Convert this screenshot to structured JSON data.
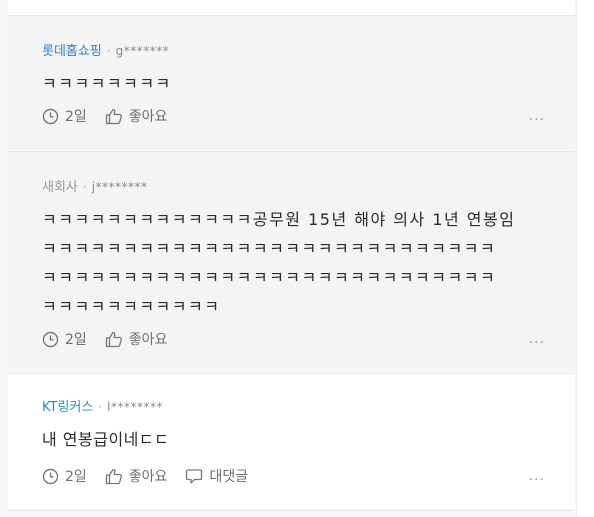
{
  "comments": [
    {
      "author": "롯데홈쇼핑",
      "separator": "·",
      "user_masked": "g*******",
      "body": "ㅋㅋㅋㅋㅋㅋㅋㅋ",
      "time": "2일",
      "like_label": "좋아요",
      "more": "..."
    },
    {
      "author": "새회사",
      "separator": "·",
      "user_masked": "j********",
      "body": "ㅋㅋㅋㅋㅋㅋㅋㅋㅋㅋㅋㅋㅋ공무원 15년 해야 의사 1년 연봉임\nㅋㅋㅋㅋㅋㅋㅋㅋㅋㅋㅋㅋㅋㅋㅋㅋㅋㅋㅋㅋㅋㅋㅋㅋㅋㅋㅋㅋ\nㅋㅋㅋㅋㅋㅋㅋㅋㅋㅋㅋㅋㅋㅋㅋㅋㅋㅋㅋㅋㅋㅋㅋㅋㅋㅋㅋㅋ\nㅋㅋㅋㅋㅋㅋㅋㅋㅋㅋㅋ",
      "time": "2일",
      "like_label": "좋아요",
      "more": "..."
    },
    {
      "author": "KT링커스",
      "separator": "·",
      "user_masked": "l********",
      "body": "내 연봉급이네ㄷㄷ",
      "time": "2일",
      "like_label": "좋아요",
      "reply_label": "대댓글",
      "more": "..."
    }
  ],
  "colors": {
    "author_blue": "#2d7fcf",
    "author_gray": "#9a9a9a",
    "author_teal": "#1d98b3",
    "reply_bg": "#f4f4f4"
  },
  "icons": [
    "clock-icon",
    "thumbs-up-icon",
    "speech-bubble-icon",
    "more-dots-icon"
  ]
}
